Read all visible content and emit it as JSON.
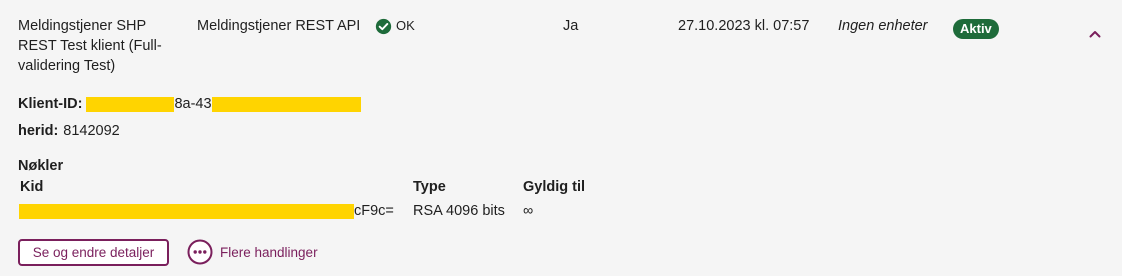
{
  "row": {
    "client_name": "Meldingstjener SHP REST Test klient (Full-validering Test)",
    "service": "Meldingstjener REST API",
    "status": {
      "label": "OK",
      "icon": "check-circle-icon"
    },
    "enabled": "Ja",
    "timestamp": "27.10.2023 kl. 07:57",
    "units": "Ingen enheter",
    "badge": "Aktiv",
    "toggle_icon": "chevron-up-icon"
  },
  "details": {
    "client_id_label": "Klient-ID:",
    "client_id_visible": "8a-43",
    "herid_label": "herid:",
    "herid_value": "8142092"
  },
  "keys": {
    "title": "Nøkler",
    "headers": {
      "kid": "Kid",
      "type": "Type",
      "valid": "Gyldig til"
    },
    "rows": [
      {
        "kid_suffix": "cF9c=",
        "type": "RSA 4096 bits",
        "valid": "∞"
      }
    ]
  },
  "actions": {
    "details_button": "Se og endre detaljer",
    "more_actions": "Flere handlinger",
    "more_icon": "more-horizontal-icon"
  },
  "colors": {
    "accent": "#7a1f5c",
    "badge": "#1e6b3a",
    "redaction": "#ffd400",
    "background": "#f5f5f5"
  }
}
